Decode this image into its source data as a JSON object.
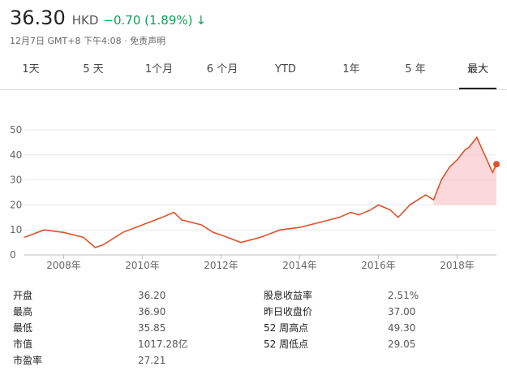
{
  "quote": {
    "price": "36.30",
    "currency": "HKD",
    "change": "−0.70 (1.89%)",
    "timestamp": "12月7日 GMT+8 下午4:08 · 免责声明"
  },
  "tabs": [
    "1天",
    "5 天",
    "1个月",
    "6 个月",
    "YTD",
    "1年",
    "5 年",
    "最大"
  ],
  "active_tab": "最大",
  "colors": {
    "line": "#e0522a",
    "fill": "#f9c8cc",
    "up_down": "#0f9d58"
  },
  "chart_data": {
    "type": "line",
    "ylim": [
      0,
      50
    ],
    "yticks": [
      "0",
      "10",
      "20",
      "30",
      "40",
      "50"
    ],
    "xticks": [
      "2008年",
      "2010年",
      "2012年",
      "2014年",
      "2016年",
      "2018年"
    ],
    "x": [
      2007.0,
      2007.5,
      2008.0,
      2008.5,
      2008.8,
      2009.0,
      2009.5,
      2010.0,
      2010.5,
      2010.8,
      2011.0,
      2011.5,
      2011.8,
      2012.0,
      2012.5,
      2013.0,
      2013.5,
      2014.0,
      2014.5,
      2015.0,
      2015.3,
      2015.5,
      2015.8,
      2016.0,
      2016.3,
      2016.5,
      2016.8,
      2017.0,
      2017.2,
      2017.4,
      2017.6,
      2017.8,
      2018.0,
      2018.2,
      2018.3,
      2018.5,
      2018.7,
      2018.9,
      2019.0
    ],
    "y": [
      7,
      10,
      9,
      7,
      3,
      4,
      9,
      12,
      15,
      17,
      14,
      12,
      9,
      8,
      5,
      7,
      10,
      11,
      13,
      15,
      17,
      16,
      18,
      20,
      18,
      15,
      20,
      22,
      24,
      22,
      30,
      35,
      38,
      42,
      43,
      47,
      40,
      33,
      36.3
    ],
    "last_value": 36.3
  },
  "stats": {
    "left": [
      {
        "label": "开盘",
        "value": "36.20"
      },
      {
        "label": "最高",
        "value": "36.90"
      },
      {
        "label": "最低",
        "value": "35.85"
      },
      {
        "label": "市值",
        "value": "1017.28亿"
      },
      {
        "label": "市盈率",
        "value": "27.21"
      }
    ],
    "right": [
      {
        "label": "股息收益率",
        "value": "2.51%"
      },
      {
        "label": "昨日收盘价",
        "value": "37.00"
      },
      {
        "label": "52 周高点",
        "value": "49.30"
      },
      {
        "label": "52 周低点",
        "value": "29.05"
      }
    ]
  }
}
